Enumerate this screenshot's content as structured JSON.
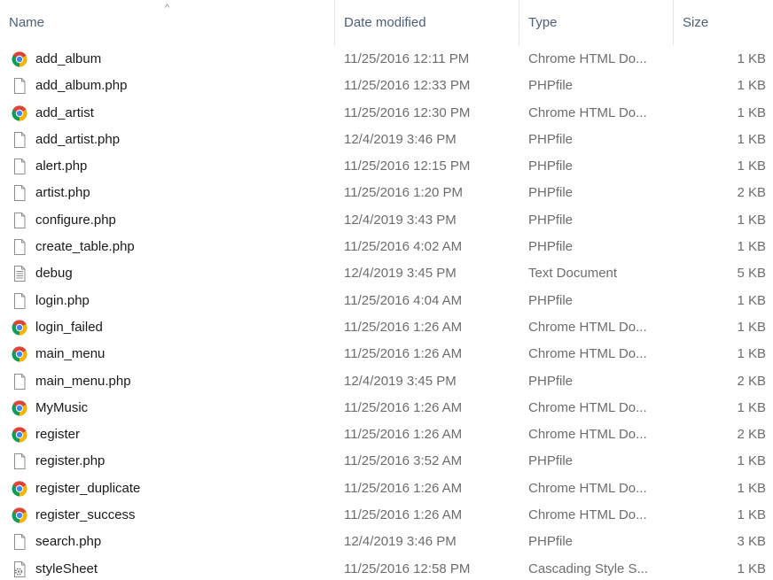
{
  "columns": {
    "name": "Name",
    "date": "Date modified",
    "type": "Type",
    "size": "Size",
    "sort_indicator": "^"
  },
  "files": [
    {
      "name": "add_album",
      "date": "11/25/2016 12:11 PM",
      "type": "Chrome HTML Do...",
      "size": "1 KB",
      "icon": "chrome"
    },
    {
      "name": "add_album.php",
      "date": "11/25/2016 12:33 PM",
      "type": "PHPfile",
      "size": "1 KB",
      "icon": "file"
    },
    {
      "name": "add_artist",
      "date": "11/25/2016 12:30 PM",
      "type": "Chrome HTML Do...",
      "size": "1 KB",
      "icon": "chrome"
    },
    {
      "name": "add_artist.php",
      "date": "12/4/2019 3:46 PM",
      "type": "PHPfile",
      "size": "1 KB",
      "icon": "file"
    },
    {
      "name": "alert.php",
      "date": "11/25/2016 12:15 PM",
      "type": "PHPfile",
      "size": "1 KB",
      "icon": "file"
    },
    {
      "name": "artist.php",
      "date": "11/25/2016 1:20 PM",
      "type": "PHPfile",
      "size": "2 KB",
      "icon": "file"
    },
    {
      "name": "configure.php",
      "date": "12/4/2019 3:43 PM",
      "type": "PHPfile",
      "size": "1 KB",
      "icon": "file"
    },
    {
      "name": "create_table.php",
      "date": "11/25/2016 4:02 AM",
      "type": "PHPfile",
      "size": "1 KB",
      "icon": "file"
    },
    {
      "name": "debug",
      "date": "12/4/2019 3:45 PM",
      "type": "Text Document",
      "size": "5 KB",
      "icon": "text"
    },
    {
      "name": "login.php",
      "date": "11/25/2016 4:04 AM",
      "type": "PHPfile",
      "size": "1 KB",
      "icon": "file"
    },
    {
      "name": "login_failed",
      "date": "11/25/2016 1:26 AM",
      "type": "Chrome HTML Do...",
      "size": "1 KB",
      "icon": "chrome"
    },
    {
      "name": "main_menu",
      "date": "11/25/2016 1:26 AM",
      "type": "Chrome HTML Do...",
      "size": "1 KB",
      "icon": "chrome"
    },
    {
      "name": "main_menu.php",
      "date": "12/4/2019 3:45 PM",
      "type": "PHPfile",
      "size": "2 KB",
      "icon": "file"
    },
    {
      "name": "MyMusic",
      "date": "11/25/2016 1:26 AM",
      "type": "Chrome HTML Do...",
      "size": "1 KB",
      "icon": "chrome"
    },
    {
      "name": "register",
      "date": "11/25/2016 1:26 AM",
      "type": "Chrome HTML Do...",
      "size": "2 KB",
      "icon": "chrome"
    },
    {
      "name": "register.php",
      "date": "11/25/2016 3:52 AM",
      "type": "PHPfile",
      "size": "1 KB",
      "icon": "file"
    },
    {
      "name": "register_duplicate",
      "date": "11/25/2016 1:26 AM",
      "type": "Chrome HTML Do...",
      "size": "1 KB",
      "icon": "chrome"
    },
    {
      "name": "register_success",
      "date": "11/25/2016 1:26 AM",
      "type": "Chrome HTML Do...",
      "size": "1 KB",
      "icon": "chrome"
    },
    {
      "name": "search.php",
      "date": "12/4/2019 3:46 PM",
      "type": "PHPfile",
      "size": "3 KB",
      "icon": "file"
    },
    {
      "name": "styleSheet",
      "date": "11/25/2016 12:58 PM",
      "type": "Cascading Style S...",
      "size": "1 KB",
      "icon": "css"
    }
  ],
  "colors": {
    "header_text": "#4c607a",
    "name_text": "#1a1a1a",
    "detail_text": "#6d6d6d",
    "chrome_red": "#db4437",
    "chrome_yellow": "#f4b400",
    "chrome_green": "#0f9d58",
    "chrome_blue": "#4285f4"
  }
}
